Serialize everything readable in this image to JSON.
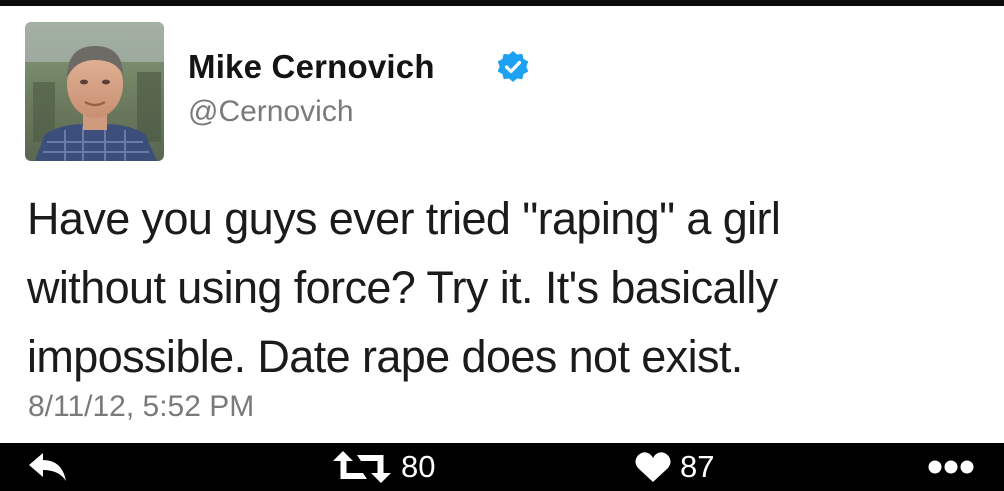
{
  "tweet": {
    "display_name": "Mike Cernovich",
    "handle": "@Cernovich",
    "verified": true,
    "text_lines": [
      "Have you guys ever tried \"raping\" a girl",
      "without using force? Try it. It's basically",
      "impossible. Date rape does not exist."
    ],
    "timestamp": "8/11/12, 5:52 PM"
  },
  "actions": {
    "reply_icon": "reply-arrow-icon",
    "retweet_icon": "retweet-icon",
    "retweet_count": "80",
    "like_icon": "heart-icon",
    "like_count": "87",
    "more_icon": "ellipsis-icon"
  },
  "colors": {
    "verified_blue": "#1da1f2",
    "action_bar_bg": "#000000",
    "secondary_text": "#7a7a7a"
  }
}
